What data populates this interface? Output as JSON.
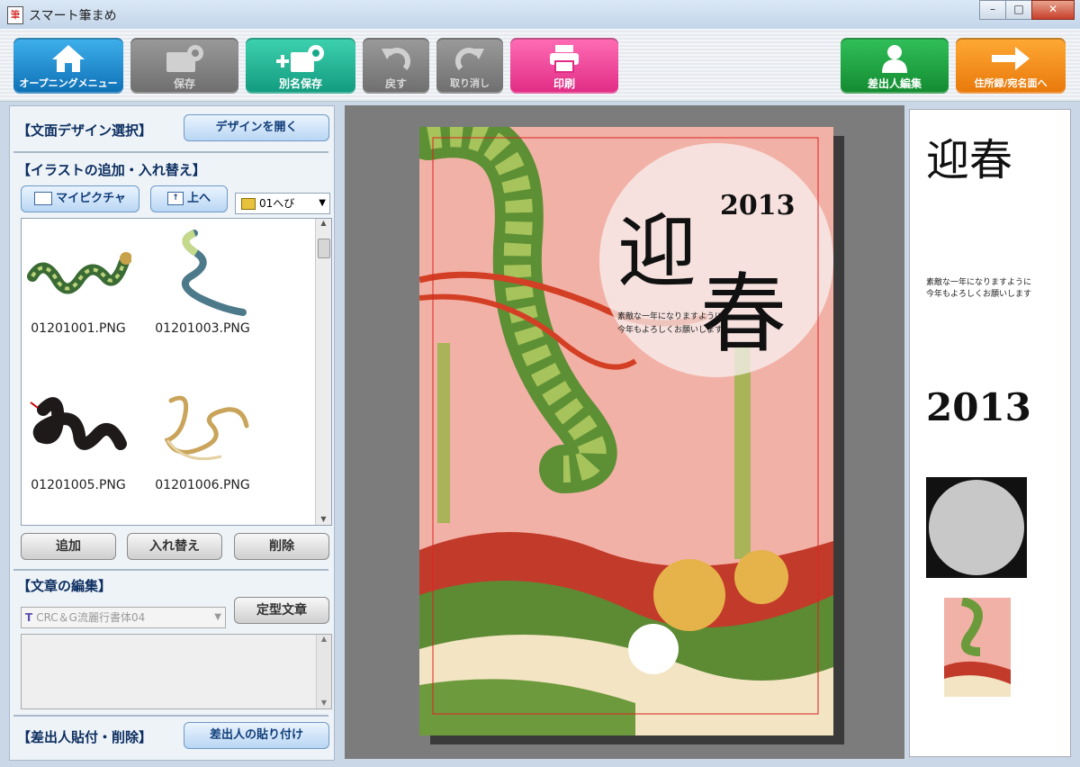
{
  "window": {
    "title": "スマート筆まめ",
    "controls": [
      "minimize",
      "maximize",
      "close"
    ]
  },
  "toolbar": {
    "opening_menu": "オープニングメニュー",
    "save": "保存",
    "save_as": "別名保存",
    "undo": "戻す",
    "redo": "取り消し",
    "print": "印刷",
    "sender_edit": "差出人編集",
    "address_book": "住所録/宛名面へ"
  },
  "left": {
    "design_section": "【文面デザイン選択】",
    "open_design": "デザインを開く",
    "illust_section": "【イラストの追加・入れ替え】",
    "my_picture": "マイピクチャ",
    "up": "上へ",
    "folder_select": "01へび",
    "thumbnails": [
      "01201001.PNG",
      "01201003.PNG",
      "01201005.PNG",
      "01201006.PNG"
    ],
    "add": "追加",
    "replace": "入れ替え",
    "delete": "削除",
    "text_section": "【文章の編集】",
    "font_select": "CRC＆G流麗行書体04",
    "template_text": "定型文章",
    "sender_section": "【差出人貼付・削除】",
    "paste_sender": "差出人の貼り付け"
  },
  "card": {
    "year": "2013",
    "kanji1": "迎",
    "kanji2": "春",
    "msg1": "素敵な一年になりますように",
    "msg2": "今年もよろしくお願いします"
  },
  "preview": {
    "greeting": "迎春",
    "message1": "素敵な一年になりますように",
    "message2": "今年もよろしくお願いします",
    "year": "2013"
  },
  "colors": {
    "home": "#1f86c9",
    "green": "#1aa88a",
    "pink": "#f0479a",
    "sender": "#1a9a3c",
    "address": "#f08a10",
    "card": "#f2b1a6"
  }
}
